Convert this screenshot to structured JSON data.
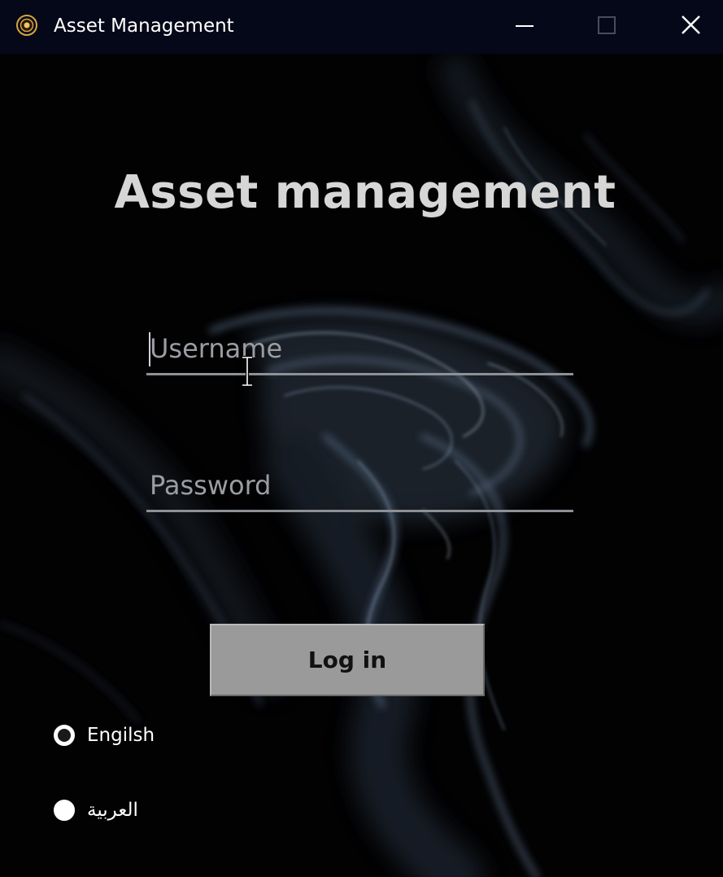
{
  "window": {
    "title": "Asset Management",
    "icon": "coin-icon",
    "controls": [
      "minimize-icon",
      "maximize-icon",
      "close-icon"
    ]
  },
  "login": {
    "heading": "Asset management",
    "username": {
      "value": "",
      "placeholder": "Username"
    },
    "password": {
      "value": "",
      "placeholder": "Password"
    },
    "submit_label": "Log in"
  },
  "language": {
    "options": [
      {
        "label": "Engilsh",
        "selected": true
      },
      {
        "label": "العربية",
        "selected": false
      }
    ]
  },
  "colors": {
    "titlebar": "#050818",
    "background": "#020203",
    "heading": "#d6d6d6",
    "button": "#9a9a9a",
    "field_line": "#8d9196"
  }
}
